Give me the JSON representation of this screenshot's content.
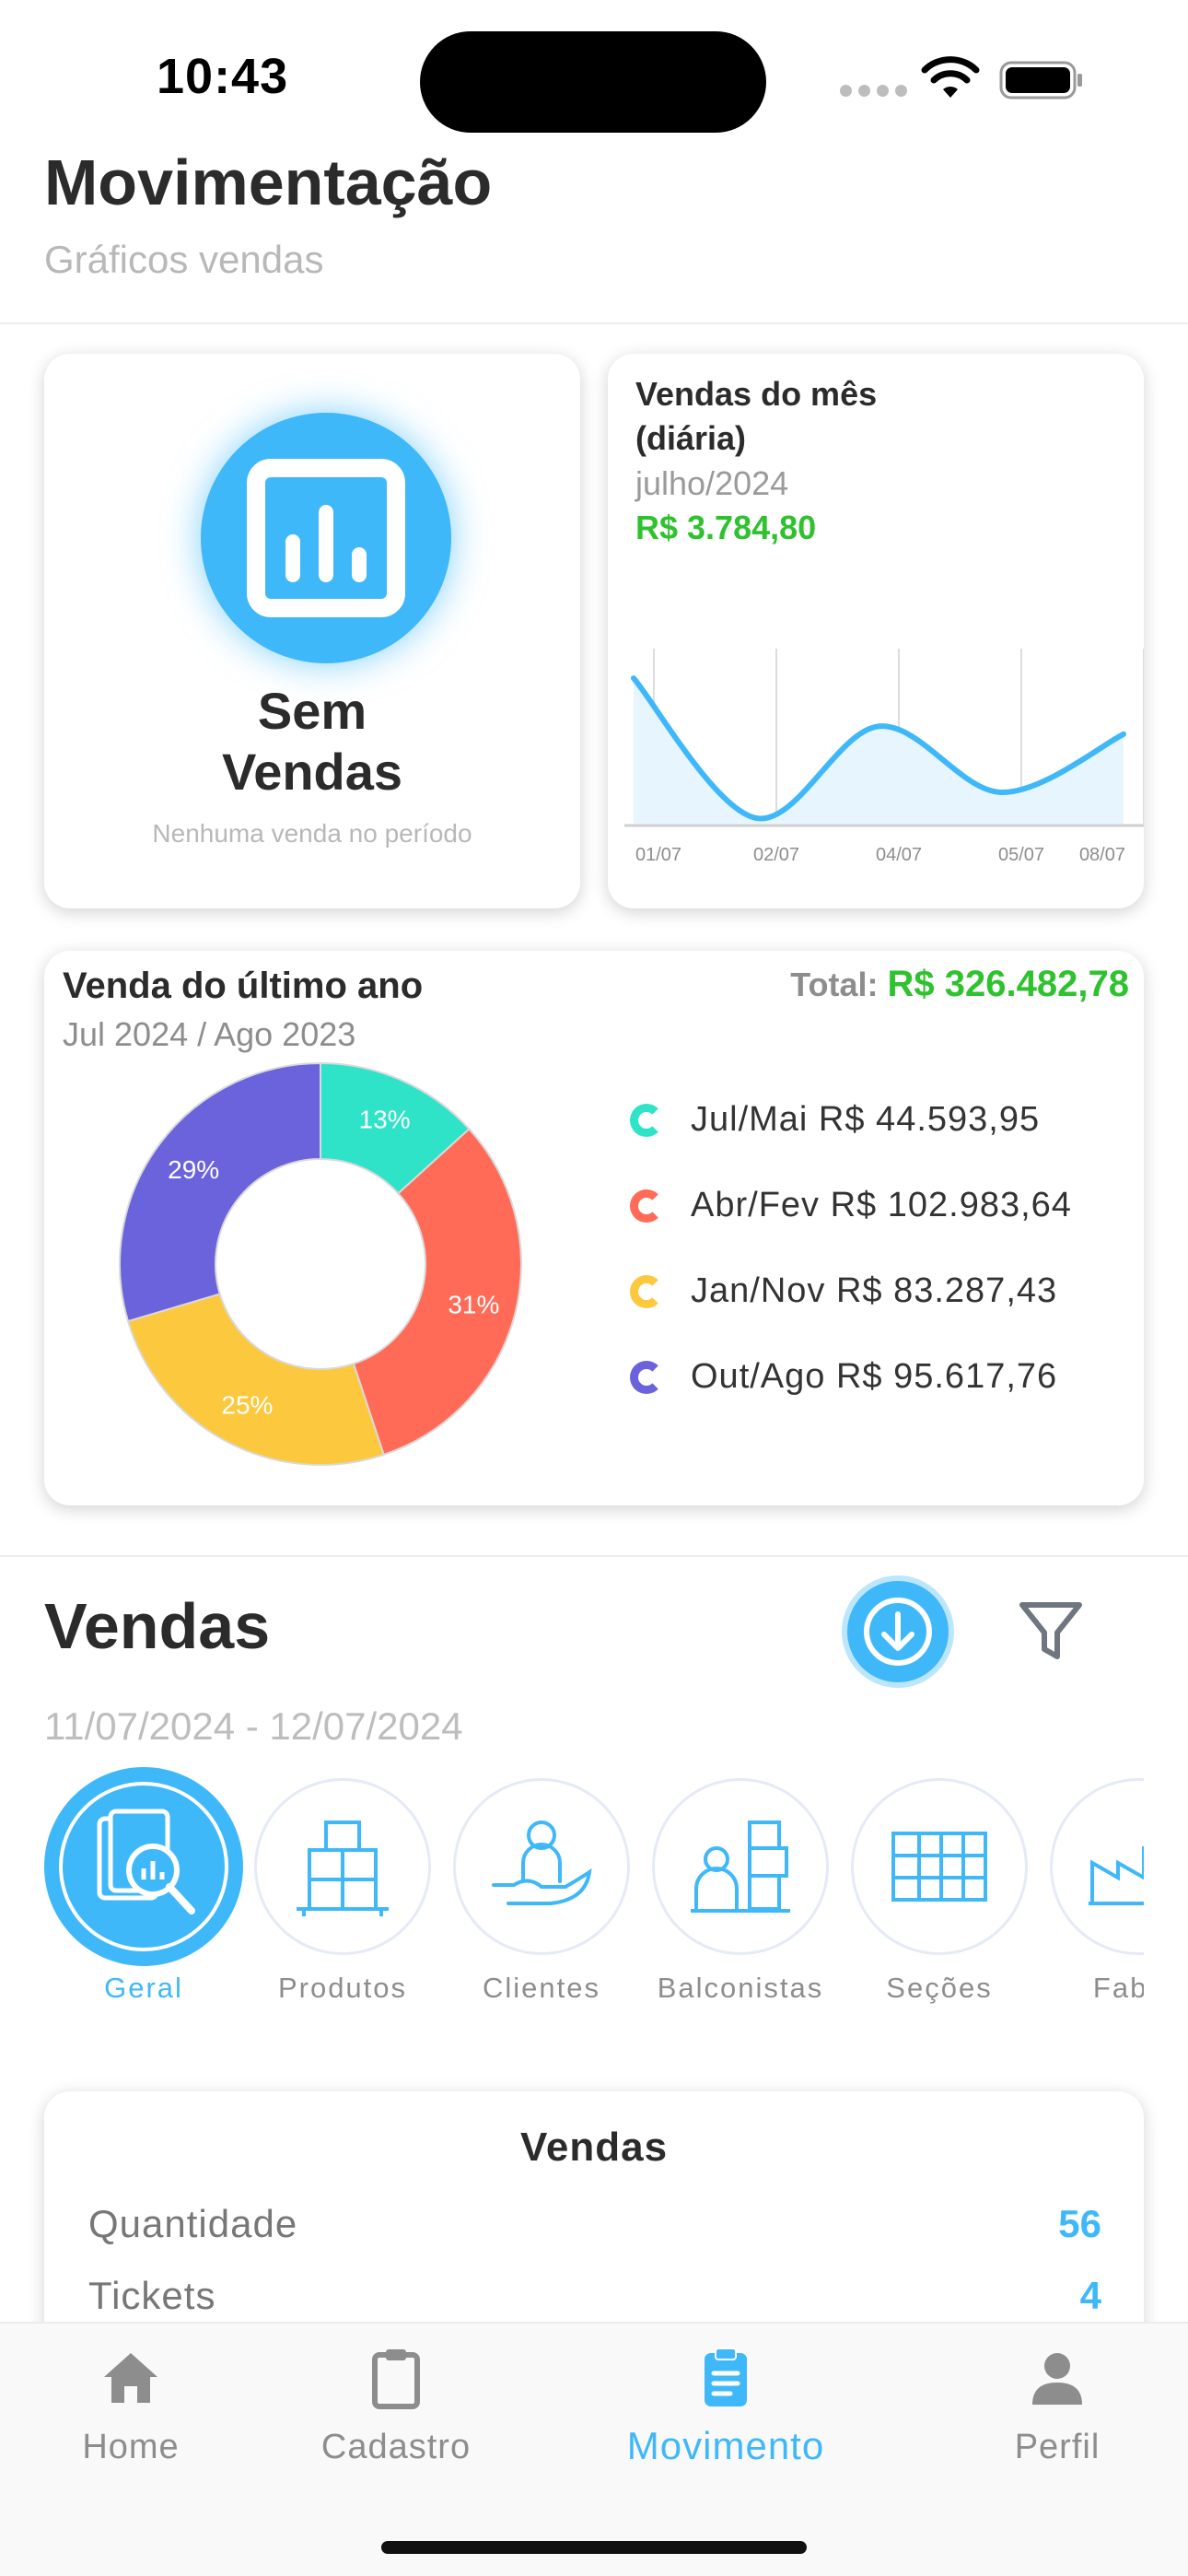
{
  "status_bar": {
    "time": "10:43"
  },
  "header": {
    "title": "Movimentação",
    "subtitle": "Gráficos vendas"
  },
  "no_sales_card": {
    "title_line1": "Sem",
    "title_line2": "Vendas",
    "subtitle": "Nenhuma venda no período"
  },
  "month_card": {
    "title": "Vendas do mês (diária)",
    "period": "julho/2024",
    "value": "R$ 3.784,80",
    "chart_data": {
      "type": "area",
      "x": [
        "01/07",
        "02/07",
        "04/07",
        "05/07",
        "08/07"
      ],
      "values": [
        1300,
        50,
        870,
        280,
        800
      ],
      "color": "#3fb8f9",
      "ylim": [
        0,
        1400
      ]
    }
  },
  "year_card": {
    "title": "Venda do último ano",
    "period": "Jul 2024 / Ago 2023",
    "total_label": "Total:",
    "total_value": "R$ 326.482,78",
    "chart_data": {
      "type": "pie",
      "categories": [
        "Jul/Mai",
        "Abr/Fev",
        "Jan/Nov",
        "Out/Ago"
      ],
      "values": [
        13,
        31,
        25,
        29
      ],
      "labels": [
        "13%",
        "31%",
        "25%",
        "29%"
      ],
      "colors": [
        "#2fe3c8",
        "#ff6b57",
        "#fcc93e",
        "#6b63dc"
      ]
    },
    "legend": [
      {
        "label": "Jul/Mai R$ 44.593,95",
        "color": "#2fe3c8"
      },
      {
        "label": "Abr/Fev R$ 102.983,64",
        "color": "#ff6b57"
      },
      {
        "label": "Jan/Nov R$ 83.287,43",
        "color": "#fcc93e"
      },
      {
        "label": "Out/Ago R$ 95.617,76",
        "color": "#6b63dc"
      }
    ]
  },
  "sales_section": {
    "title": "Vendas",
    "date_range": "11/07/2024 - 12/07/2024",
    "categories": [
      {
        "label": "Geral",
        "icon": "report-search-icon",
        "active": true
      },
      {
        "label": "Produtos",
        "icon": "boxes-icon",
        "active": false
      },
      {
        "label": "Clientes",
        "icon": "client-hand-icon",
        "active": false
      },
      {
        "label": "Balconistas",
        "icon": "clerk-icon",
        "active": false
      },
      {
        "label": "Seções",
        "icon": "shelves-icon",
        "active": false
      },
      {
        "label": "Fabric",
        "icon": "factory-icon",
        "active": false
      }
    ]
  },
  "summary": {
    "title": "Vendas",
    "rows": [
      {
        "label": "Quantidade",
        "value": "56"
      },
      {
        "label": "Tickets",
        "value": "4"
      }
    ]
  },
  "tabbar": {
    "items": [
      {
        "label": "Home",
        "icon": "home-icon"
      },
      {
        "label": "Cadastro",
        "icon": "clipboard-icon"
      },
      {
        "label": "Movimento",
        "icon": "clipboard-list-icon",
        "active": true
      },
      {
        "label": "Perfil",
        "icon": "user-icon"
      }
    ]
  },
  "colors": {
    "accent": "#3fb8f9",
    "positive": "#2fc22f"
  }
}
